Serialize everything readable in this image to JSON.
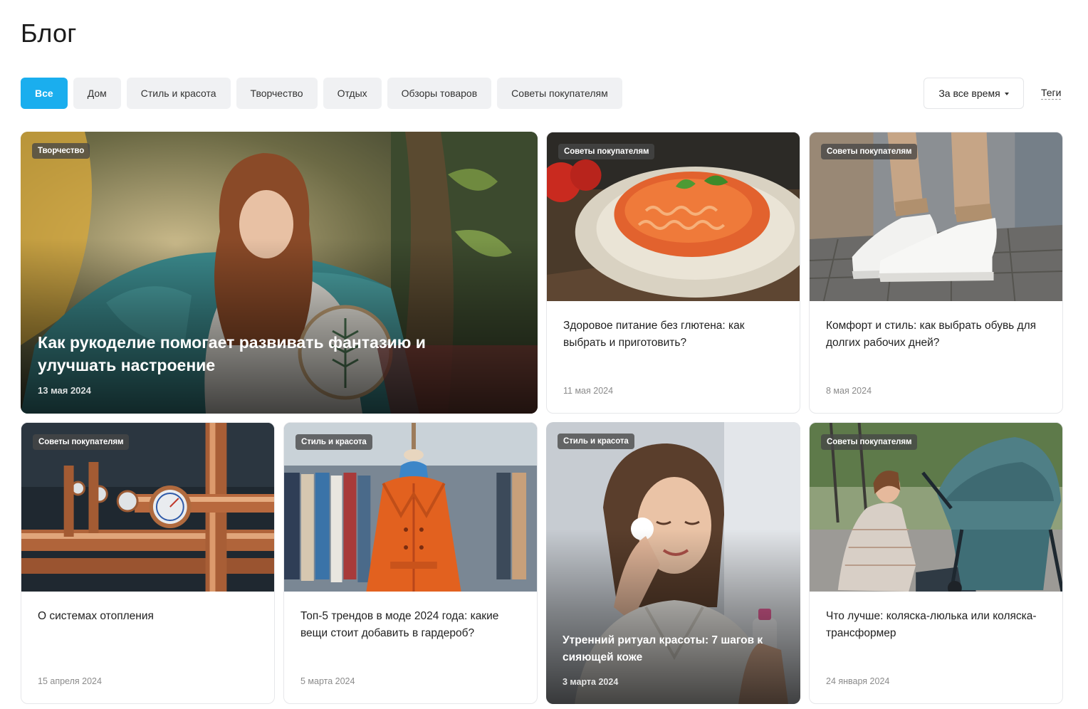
{
  "page": {
    "title": "Блог"
  },
  "filters": [
    {
      "label": "Все",
      "active": true
    },
    {
      "label": "Дом",
      "active": false
    },
    {
      "label": "Стиль и красота",
      "active": false
    },
    {
      "label": "Творчество",
      "active": false
    },
    {
      "label": "Отдых",
      "active": false
    },
    {
      "label": "Обзоры товаров",
      "active": false
    },
    {
      "label": "Советы покупателям",
      "active": false
    }
  ],
  "period": {
    "label": "За все время"
  },
  "tags_link": "Теги",
  "colors": {
    "accent": "#1aaeee",
    "chip_bg": "#f0f1f3",
    "date": "#8b8b8b"
  },
  "posts": [
    {
      "category": "Творчество",
      "title": "Как рукоделие помогает развивать фантазию и улучшать настроение",
      "date": "13 мая 2024",
      "image": "woman-embroidery"
    },
    {
      "category": "Советы покупателям",
      "title": "Здоровое питание без глютена: как выбрать и приготовить?",
      "date": "11 мая 2024",
      "image": "pasta-plate"
    },
    {
      "category": "Советы покупателям",
      "title": "Комфорт и стиль: как выбрать обувь для долгих рабочих дней?",
      "date": "8 мая 2024",
      "image": "white-sneakers"
    },
    {
      "category": "Советы покупателям",
      "title": "О системах отопления",
      "date": "15 апреля 2024",
      "image": "heating-pipes"
    },
    {
      "category": "Стиль и красота",
      "title": "Топ-5 трендов в моде 2024 года: какие вещи стоит добавить в гардероб?",
      "date": "5 марта 2024",
      "image": "orange-coat-mannequin"
    },
    {
      "category": "Стиль и красота",
      "title": "Утренний ритуал красоты: 7 шагов к сияющей коже",
      "date": "3 марта 2024",
      "image": "woman-skincare"
    },
    {
      "category": "Советы покупателям",
      "title": "Что лучше: коляска-люлька или коляска-трансформер",
      "date": "24 января 2024",
      "image": "baby-stroller"
    }
  ]
}
